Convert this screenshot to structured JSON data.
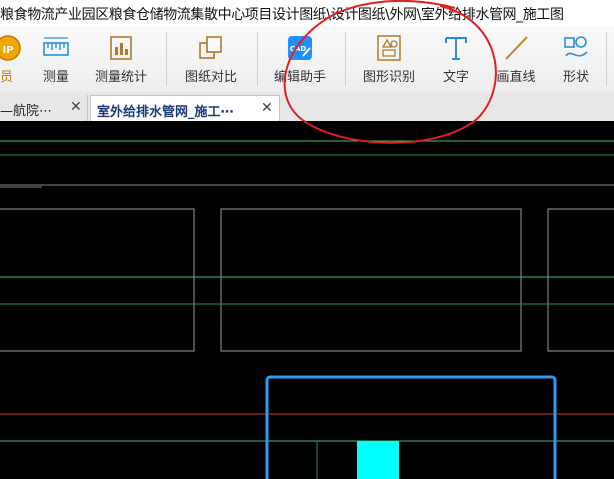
{
  "window": {
    "title": "粮食物流产业园区粮食仓储物流集散中心项目设计图纸\\设计图纸\\外网\\室外给排水管网_施工图"
  },
  "toolbar": {
    "items": [
      {
        "label": "员",
        "icon": "vip-icon"
      },
      {
        "label": "测量",
        "icon": "measure-icon"
      },
      {
        "label": "测量统计",
        "icon": "measure-stats-icon"
      },
      {
        "label": "图纸对比",
        "icon": "compare-icon"
      },
      {
        "label": "编辑助手",
        "icon": "cad-edit-icon"
      },
      {
        "label": "图形识别",
        "icon": "shape-recognition-icon"
      },
      {
        "label": "文字",
        "icon": "text-icon"
      },
      {
        "label": "画直线",
        "icon": "line-icon"
      },
      {
        "label": "形状",
        "icon": "shape-icon"
      }
    ]
  },
  "tabs": [
    {
      "label": "—航院⋯",
      "active": false,
      "close": "✕"
    },
    {
      "label": "室外给排水管网_施工⋯",
      "active": true,
      "close": "✕"
    }
  ],
  "colors": {
    "accent": "#1e90ff",
    "highlight_circle": "#e02020",
    "drawing_green": "#3fbf6f",
    "drawing_red": "#d23a3a",
    "drawing_cyan": "#00ffff",
    "drawing_box": "#2a9df4"
  }
}
